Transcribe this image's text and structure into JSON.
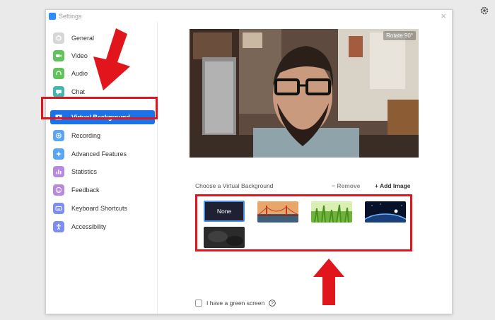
{
  "window": {
    "title": "Settings"
  },
  "sidebar": {
    "items": [
      {
        "label": "General",
        "icon": "gear-icon",
        "color": "#bdbdbd"
      },
      {
        "label": "Video",
        "icon": "video-camera-icon",
        "color": "#5fc45a"
      },
      {
        "label": "Audio",
        "icon": "headphones-icon",
        "color": "#5fc45a"
      },
      {
        "label": "Chat",
        "icon": "chat-bubble-icon",
        "color": "#3cb9b0"
      },
      {
        "label": "Virtual Background",
        "icon": "person-card-icon",
        "color": "#ffffff",
        "active": true
      },
      {
        "label": "Recording",
        "icon": "record-icon",
        "color": "#5aa5f5"
      },
      {
        "label": "Advanced Features",
        "icon": "sparkle-icon",
        "color": "#5aa5f5"
      },
      {
        "label": "Statistics",
        "icon": "bar-chart-icon",
        "color": "#b58ae0"
      },
      {
        "label": "Feedback",
        "icon": "smiley-icon",
        "color": "#b58ae0"
      },
      {
        "label": "Keyboard Shortcuts",
        "icon": "keyboard-icon",
        "color": "#7d8ef0"
      },
      {
        "label": "Accessibility",
        "icon": "accessibility-icon",
        "color": "#7d8ef0"
      }
    ]
  },
  "main": {
    "rotate_label": "Rotate 90°",
    "choose_label": "Choose a Virtual Background",
    "remove_label": "− Remove",
    "add_image_label": "+ Add Image",
    "thumbnails": [
      {
        "label": "None",
        "selected": true
      },
      {
        "name": "golden-gate-bridge"
      },
      {
        "name": "grass"
      },
      {
        "name": "earth-from-space"
      },
      {
        "name": "dark-blur"
      }
    ],
    "green_screen_label": "I have a green screen"
  },
  "colors": {
    "accent": "#1a73e8",
    "highlight_red": "#e0161c"
  }
}
